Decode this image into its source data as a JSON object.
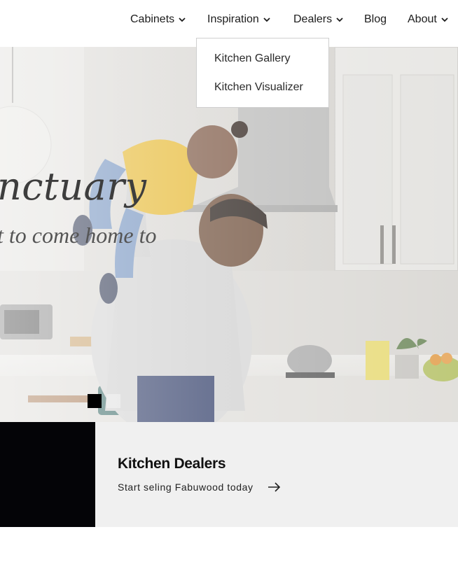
{
  "nav": {
    "items": [
      {
        "label": "Cabinets",
        "has_dropdown": true
      },
      {
        "label": "Inspiration",
        "has_dropdown": true
      },
      {
        "label": "Dealers",
        "has_dropdown": true
      },
      {
        "label": "Blog",
        "has_dropdown": false
      },
      {
        "label": "About",
        "has_dropdown": true
      }
    ],
    "icon": "chevron-down-icon"
  },
  "dropdown": {
    "items": [
      "Kitchen Gallery",
      "Kitchen Visualizer"
    ]
  },
  "hero": {
    "title": "nctuary",
    "subtitle": "t to come home to",
    "slides": {
      "count": 2,
      "active_index": 0
    }
  },
  "promo": {
    "title": "Kitchen Dealers",
    "link_label": "Start seling Fabuwood today",
    "link_icon": "arrow-right-icon"
  },
  "colors": {
    "text": "#1c1c1c",
    "promo_block": "#040407",
    "promo_background": "#f0f0f0",
    "dropdown_border": "#cfcfcf"
  }
}
